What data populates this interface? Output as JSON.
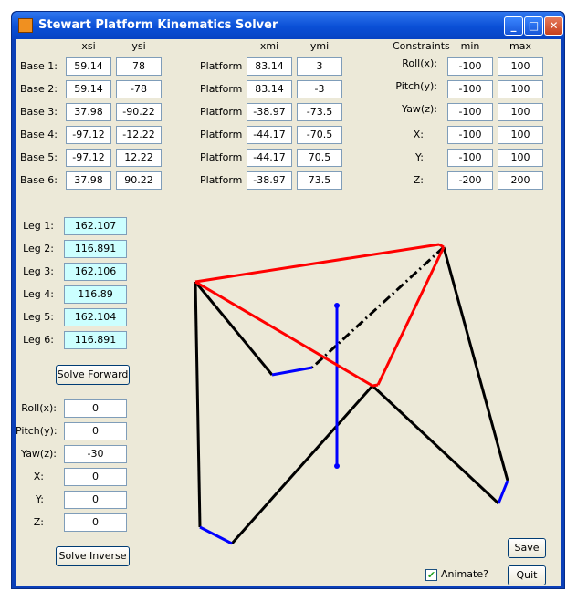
{
  "window": {
    "title": "Stewart Platform Kinematics Solver",
    "min": "_",
    "max": "□",
    "close": "✕"
  },
  "headers": {
    "xsi": "xsi",
    "ysi": "ysi",
    "xmi": "xmi",
    "ymi": "ymi",
    "constraints": "Constraints",
    "min": "min",
    "max": "max"
  },
  "base": [
    {
      "label": "Base 1:",
      "x": "59.14",
      "y": "78"
    },
    {
      "label": "Base 2:",
      "x": "59.14",
      "y": "-78"
    },
    {
      "label": "Base 3:",
      "x": "37.98",
      "y": "-90.22"
    },
    {
      "label": "Base 4:",
      "x": "-97.12",
      "y": "-12.22"
    },
    {
      "label": "Base 5:",
      "x": "-97.12",
      "y": "12.22"
    },
    {
      "label": "Base 6:",
      "x": "37.98",
      "y": "90.22"
    }
  ],
  "platform": [
    {
      "label": "Platform",
      "x": "83.14",
      "y": "3"
    },
    {
      "label": "Platform",
      "x": "83.14",
      "y": "-3"
    },
    {
      "label": "Platform",
      "x": "-38.97",
      "y": "-73.5"
    },
    {
      "label": "Platform",
      "x": "-44.17",
      "y": "-70.5"
    },
    {
      "label": "Platform",
      "x": "-44.17",
      "y": "70.5"
    },
    {
      "label": "Platform",
      "x": "-38.97",
      "y": "73.5"
    }
  ],
  "constraints": [
    {
      "label": "Roll(x):",
      "min": "-100",
      "max": "100"
    },
    {
      "label": "Pitch(y):",
      "min": "-100",
      "max": "100"
    },
    {
      "label": "Yaw(z):",
      "min": "-100",
      "max": "100"
    },
    {
      "label": "X:",
      "min": "-100",
      "max": "100"
    },
    {
      "label": "Y:",
      "min": "-100",
      "max": "100"
    },
    {
      "label": "Z:",
      "min": "-200",
      "max": "200"
    }
  ],
  "legs": [
    {
      "label": "Leg 1:",
      "value": "162.107"
    },
    {
      "label": "Leg 2:",
      "value": "116.891"
    },
    {
      "label": "Leg 3:",
      "value": "162.106"
    },
    {
      "label": "Leg 4:",
      "value": "116.89"
    },
    {
      "label": "Leg 5:",
      "value": "162.104"
    },
    {
      "label": "Leg 6:",
      "value": "116.891"
    }
  ],
  "solve_forward": "Solve Forward",
  "pose": [
    {
      "label": "Roll(x):",
      "value": "0"
    },
    {
      "label": "Pitch(y):",
      "value": "0"
    },
    {
      "label": "Yaw(z):",
      "value": "-30"
    },
    {
      "label": "X:",
      "value": "0"
    },
    {
      "label": "Y:",
      "value": "0"
    },
    {
      "label": "Z:",
      "value": "0"
    }
  ],
  "solve_inverse": "Solve Inverse",
  "animate": {
    "label": "Animate?",
    "checked": true
  },
  "save": "Save",
  "quit": "Quit",
  "colors": {
    "platform": "#ff0000",
    "legs": "#000000",
    "base_edge": "#0000ff",
    "axis": "#0000ff"
  }
}
